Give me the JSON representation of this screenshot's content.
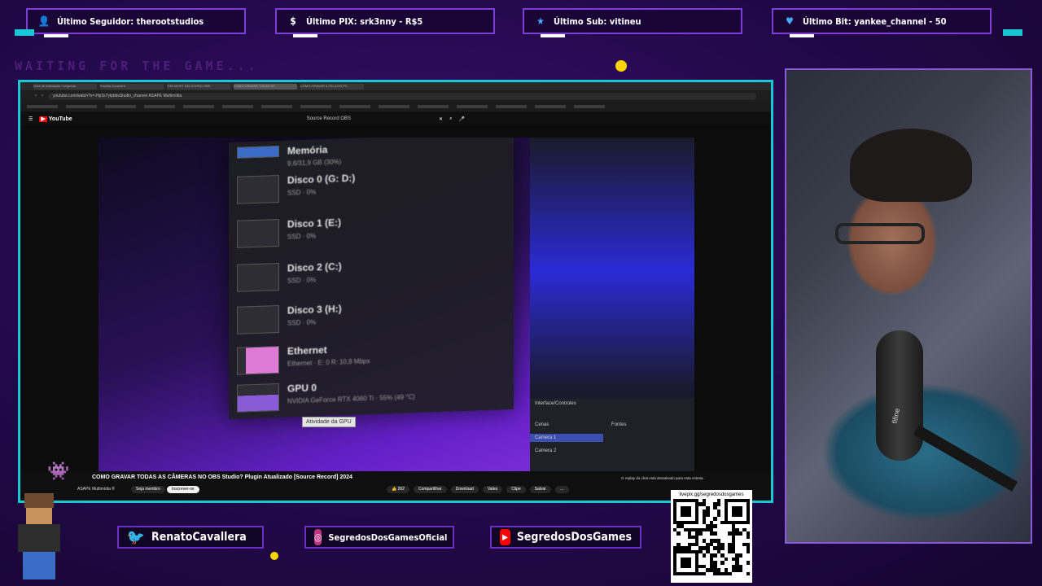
{
  "alerts": [
    {
      "icon": "user-icon",
      "label": "Último Seguidor: therootstudios"
    },
    {
      "icon": "dollar-icon",
      "label": "Último PIX: srk3nny - R$5"
    },
    {
      "icon": "star-icon",
      "label": "Último Sub: vitineu"
    },
    {
      "icon": "heart-icon",
      "label": "Último Bit: yankee_channel - 50"
    }
  ],
  "waiting_text": "WAITING FOR THE GAME...",
  "browser": {
    "tabs": [
      "Guia de instalação / segunda",
      "Família Zocaverá",
      "THE MOST DELICATED OBS",
      "COMO GRAVAR TODAS AS",
      "COMO GRAVAR A TELA DO PC"
    ],
    "url": "youtube.com/watch?v=-Hp3s7ylpbbsStudio_channel ASAPE Multimídia",
    "youtube_logo": "YouTube",
    "video_search_title": "Source Record OBS",
    "video": {
      "task_manager": [
        {
          "name": "Memória",
          "sub": "9,6/31,9 GB (30%)"
        },
        {
          "name": "Disco 0 (G: D:)",
          "sub": "SSD · 0%"
        },
        {
          "name": "Disco 1 (E:)",
          "sub": "SSD · 0%"
        },
        {
          "name": "Disco 2 (C:)",
          "sub": "SSD · 0%"
        },
        {
          "name": "Disco 3 (H:)",
          "sub": "SSD · 0%"
        },
        {
          "name": "Ethernet",
          "sub": "Ethernet · E: 0 R: 10,8 Mbps"
        },
        {
          "name": "GPU 0",
          "sub": "NVIDIA GeForce RTX 4060 Ti · 55% (49 °C)"
        }
      ],
      "tooltip": "Atividade da GPU",
      "obs_labels": [
        "Interface/Controles",
        "Cenas",
        "Fontes",
        "Camera 1",
        "Camera 2"
      ]
    },
    "video_title": "COMO GRAVAR TODAS AS CÂMERAS NO OBS Studio? Plugin Atualizado [Source Record] 2024",
    "channel_name": "ASAPE Multimídia ®",
    "join_label": "Seja membro",
    "subscribe_label": "Inscrever-se",
    "actions": [
      "👍 262",
      "Compartilhar",
      "Download",
      "Valeu",
      "Clipe",
      "Salvar",
      "…"
    ],
    "chat_note": "O replay do chat está desativado para esta estreia."
  },
  "webcam": {
    "mic_brand": "fifine"
  },
  "socials": [
    {
      "icon": "twitter-icon",
      "label": "RenatoCavallera",
      "color": "#1da1f2"
    },
    {
      "icon": "instagram-icon",
      "label": "SegredosDosGamesOficial",
      "color": "#c13584"
    },
    {
      "icon": "youtube-icon",
      "label": "SegredosDosGames",
      "color": "#ff0000"
    }
  ],
  "qr": {
    "url": "livepix.gg/segredosdosgames"
  },
  "colors": {
    "accent": "#19c8d6",
    "frame": "#7d3dd6",
    "background": "#22094a"
  }
}
